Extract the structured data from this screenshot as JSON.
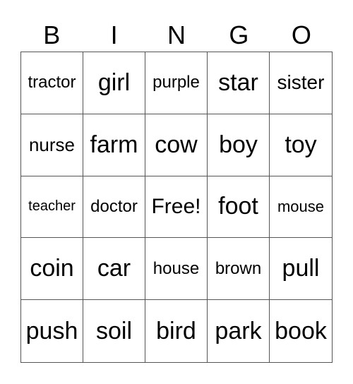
{
  "header": [
    "B",
    "I",
    "N",
    "G",
    "O"
  ],
  "cells": [
    {
      "text": "tractor",
      "size": 24
    },
    {
      "text": "girl",
      "size": 34
    },
    {
      "text": "purple",
      "size": 24
    },
    {
      "text": "star",
      "size": 34
    },
    {
      "text": "sister",
      "size": 28
    },
    {
      "text": "nurse",
      "size": 26
    },
    {
      "text": "farm",
      "size": 34
    },
    {
      "text": "cow",
      "size": 34
    },
    {
      "text": "boy",
      "size": 34
    },
    {
      "text": "toy",
      "size": 34
    },
    {
      "text": "teacher",
      "size": 20
    },
    {
      "text": "doctor",
      "size": 24
    },
    {
      "text": "Free!",
      "size": 30
    },
    {
      "text": "foot",
      "size": 34
    },
    {
      "text": "mouse",
      "size": 22
    },
    {
      "text": "coin",
      "size": 34
    },
    {
      "text": "car",
      "size": 34
    },
    {
      "text": "house",
      "size": 24
    },
    {
      "text": "brown",
      "size": 24
    },
    {
      "text": "pull",
      "size": 34
    },
    {
      "text": "push",
      "size": 34
    },
    {
      "text": "soil",
      "size": 34
    },
    {
      "text": "bird",
      "size": 34
    },
    {
      "text": "park",
      "size": 34
    },
    {
      "text": "book",
      "size": 34
    }
  ]
}
